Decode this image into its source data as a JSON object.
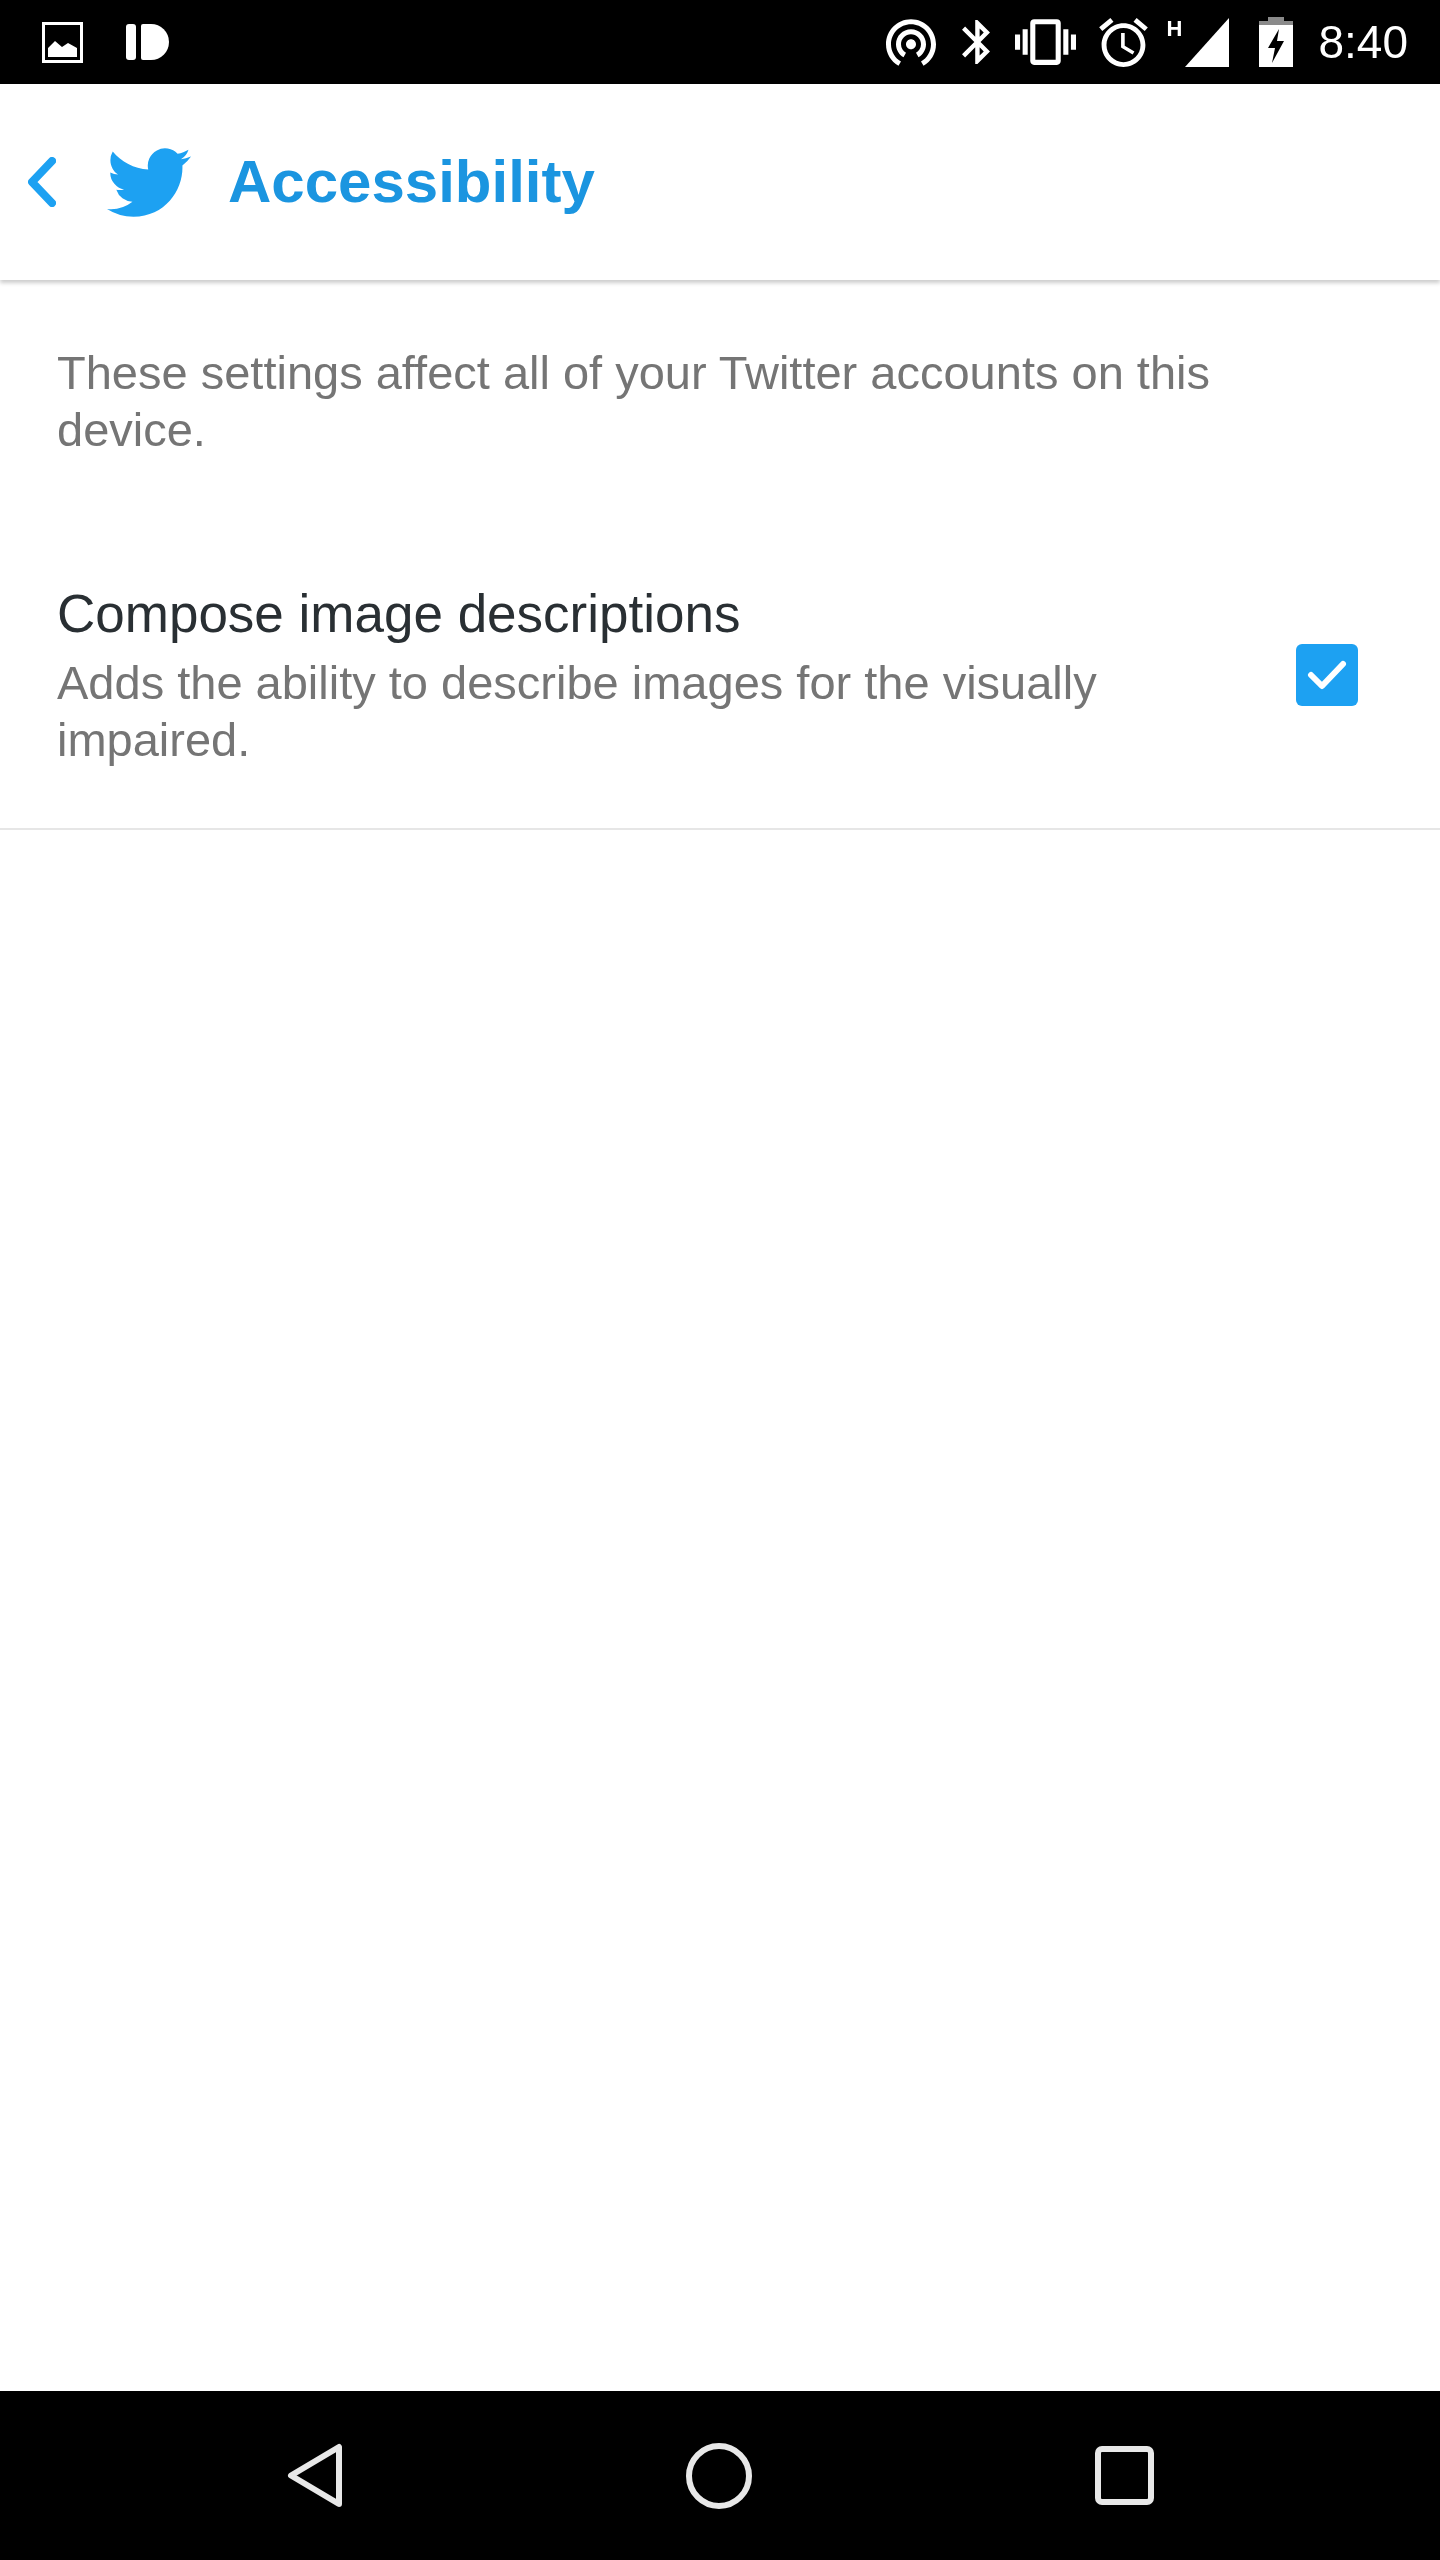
{
  "status_bar": {
    "network_type": "H",
    "time": "8:40"
  },
  "app_bar": {
    "title": "Accessibility"
  },
  "description": "These settings affect all of your Twitter accounts on this device.",
  "settings": [
    {
      "title": "Compose image descriptions",
      "subtitle": "Adds the ability to describe images for the visually impaired.",
      "checked": true
    }
  ]
}
